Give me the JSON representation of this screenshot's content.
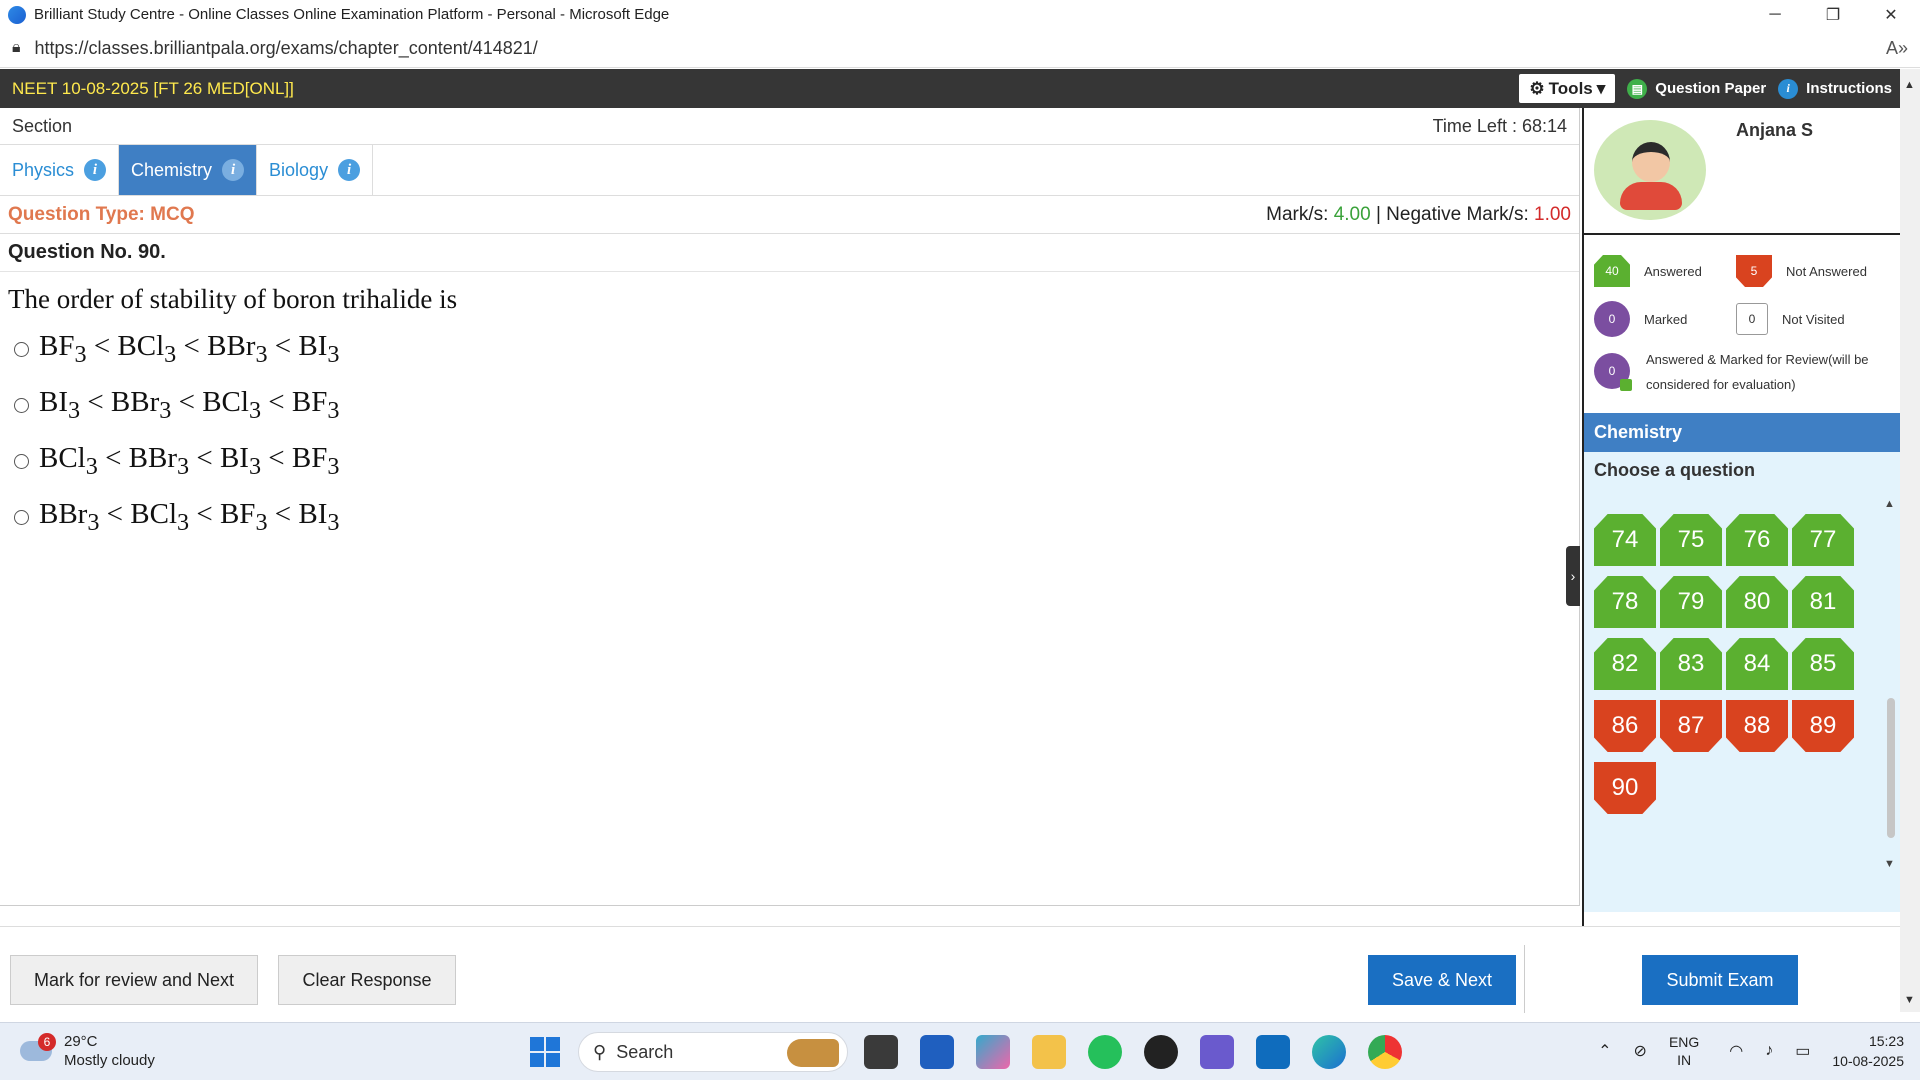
{
  "window": {
    "title": "Brilliant Study Centre - Online Classes Online Examination Platform - Personal - Microsoft Edge"
  },
  "address": {
    "url": "https://classes.brilliantpala.org/exams/chapter_content/414821/"
  },
  "topbar": {
    "exam_name": "NEET 10-08-2025 [FT 26 MED[ONL]]",
    "tools_label": "Tools",
    "question_paper_label": "Question Paper",
    "instructions_label": "Instructions"
  },
  "section": {
    "label": "Section",
    "time_left_label": "Time Left : ",
    "time_left_value": "68:14"
  },
  "tabs": [
    {
      "label": "Physics"
    },
    {
      "label": "Chemistry"
    },
    {
      "label": "Biology"
    }
  ],
  "question": {
    "type_label": "Question Type: MCQ",
    "marks_label": "Mark/s: ",
    "marks_value": "4.00",
    "neg_marks_label": " | Negative Mark/s: ",
    "neg_marks_value": "1.00",
    "number_label": "Question No. 90.",
    "text": "The order of stability of boron trihalide is",
    "options": [
      {
        "html": "BF<sub>3</sub> &lt; BCl<sub>3</sub> &lt; BBr<sub>3</sub> &lt; BI<sub>3</sub>"
      },
      {
        "html": "BI<sub>3</sub> &lt; BBr<sub>3</sub> &lt; BCl<sub>3</sub> &lt; BF<sub>3</sub>"
      },
      {
        "html": "BCl<sub>3</sub> &lt; BBr<sub>3</sub> &lt; BI<sub>3</sub> &lt; BF<sub>3</sub>"
      },
      {
        "html": "BBr<sub>3</sub> &lt; BCl<sub>3</sub> &lt; BF<sub>3</sub> &lt; BI<sub>3</sub>"
      }
    ]
  },
  "profile": {
    "name": "Anjana S"
  },
  "legend": {
    "answered_count": "40",
    "answered_label": "Answered",
    "not_answered_count": "5",
    "not_answered_label": "Not Answered",
    "marked_count": "0",
    "marked_label": "Marked",
    "not_visited_count": "0",
    "not_visited_label": "Not Visited",
    "ans_marked_count": "0",
    "ans_marked_label": "Answered & Marked for Review(will be considered for evaluation)"
  },
  "palette": {
    "section_name": "Chemistry",
    "choose_label": "Choose a question",
    "questions": [
      {
        "n": "74",
        "status": "answered"
      },
      {
        "n": "75",
        "status": "answered"
      },
      {
        "n": "76",
        "status": "answered"
      },
      {
        "n": "77",
        "status": "answered"
      },
      {
        "n": "78",
        "status": "answered"
      },
      {
        "n": "79",
        "status": "answered"
      },
      {
        "n": "80",
        "status": "answered"
      },
      {
        "n": "81",
        "status": "answered"
      },
      {
        "n": "82",
        "status": "answered"
      },
      {
        "n": "83",
        "status": "answered"
      },
      {
        "n": "84",
        "status": "answered"
      },
      {
        "n": "85",
        "status": "answered"
      },
      {
        "n": "86",
        "status": "not-answered"
      },
      {
        "n": "87",
        "status": "not-answered"
      },
      {
        "n": "88",
        "status": "not-answered"
      },
      {
        "n": "89",
        "status": "not-answered"
      },
      {
        "n": "90",
        "status": "not-answered"
      }
    ]
  },
  "actions": {
    "mark_review": "Mark for review and Next",
    "clear": "Clear Response",
    "save_next": "Save & Next",
    "submit": "Submit Exam"
  },
  "taskbar": {
    "temp": "29°C",
    "weather": "Mostly cloudy",
    "weather_badge": "6",
    "search": "Search",
    "lang1": "ENG",
    "lang2": "IN",
    "time": "15:23",
    "date": "10-08-2025"
  },
  "colors": {
    "accent": "#3f7fc4",
    "answered": "#5bb030",
    "not_answered": "#d9431f",
    "marked": "#7b4ea0",
    "topbar": "#363636",
    "exam_title": "#ffe94d"
  }
}
